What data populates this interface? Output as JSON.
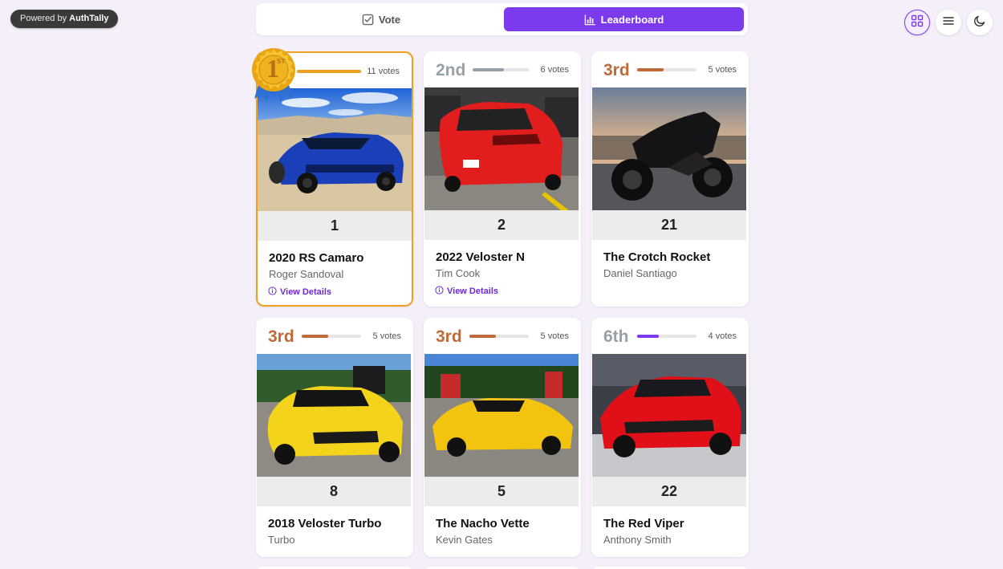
{
  "brand": {
    "powered_prefix": "Powered by",
    "powered_name": "AuthTally"
  },
  "tabs": {
    "vote": "Vote",
    "leaderboard": "Leaderboard",
    "active": "leaderboard"
  },
  "header_icons": [
    "grid-icon",
    "menu-icon",
    "moon-icon"
  ],
  "medal": {
    "digit": "1",
    "suffix": "ST"
  },
  "colors": {
    "accent": "#7c3aed",
    "gold": "#f0a020",
    "silver": "#9aa0a8",
    "bronze": "#c06a3a"
  },
  "entries": [
    {
      "rank_label": "",
      "votes": "11 votes",
      "vote_fraction": 1.0,
      "number": "1",
      "title": "2020 RS Camaro",
      "owner": "Roger Sandoval",
      "link": "View Details",
      "first": true
    },
    {
      "rank_label": "2nd",
      "votes": "6 votes",
      "vote_fraction": 0.55,
      "number": "2",
      "title": "2022 Veloster N",
      "owner": "Tim Cook",
      "link": "View Details"
    },
    {
      "rank_label": "3rd",
      "votes": "5 votes",
      "vote_fraction": 0.45,
      "number": "21",
      "title": "The Crotch Rocket",
      "owner": "Daniel Santiago"
    },
    {
      "rank_label": "3rd",
      "votes": "5 votes",
      "vote_fraction": 0.45,
      "number": "8",
      "title": "2018 Veloster Turbo",
      "owner": "Turbo"
    },
    {
      "rank_label": "3rd",
      "votes": "5 votes",
      "vote_fraction": 0.45,
      "number": "5",
      "title": "The Nacho Vette",
      "owner": "Kevin Gates"
    },
    {
      "rank_label": "6th",
      "votes": "4 votes",
      "vote_fraction": 0.36,
      "number": "22",
      "title": "The Red Viper",
      "owner": "Anthony Smith"
    }
  ]
}
